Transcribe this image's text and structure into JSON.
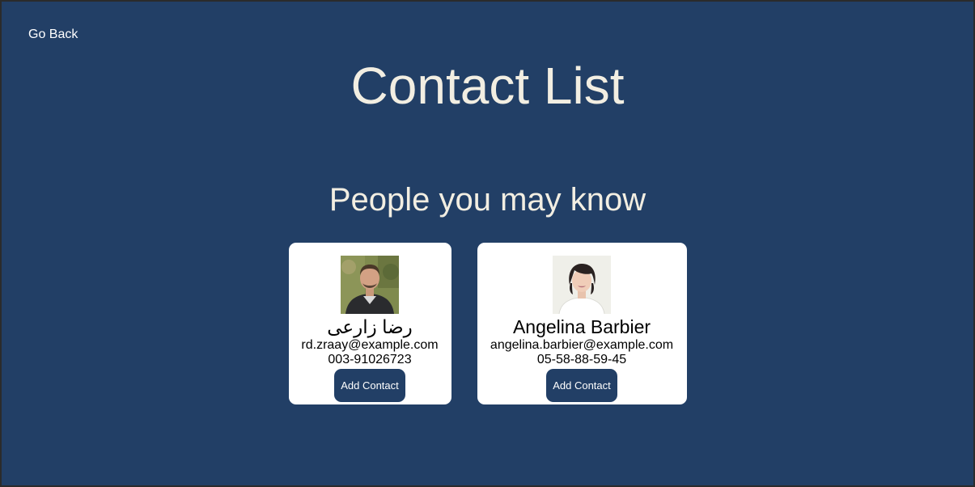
{
  "nav": {
    "go_back_label": "Go Back"
  },
  "header": {
    "title": "Contact List"
  },
  "suggestions": {
    "title": "People you may know",
    "people": [
      {
        "name": "رضا زارعی",
        "email": "rd.zraay@example.com",
        "phone": "003-91026723",
        "button_label": "Add Contact"
      },
      {
        "name": "Angelina Barbier",
        "email": "angelina.barbier@example.com",
        "phone": "05-58-88-59-45",
        "button_label": "Add Contact"
      }
    ]
  },
  "colors": {
    "background": "#223f66",
    "heading_text": "#f2eee2",
    "card_background": "#ffffff",
    "button_background": "#223f66"
  }
}
